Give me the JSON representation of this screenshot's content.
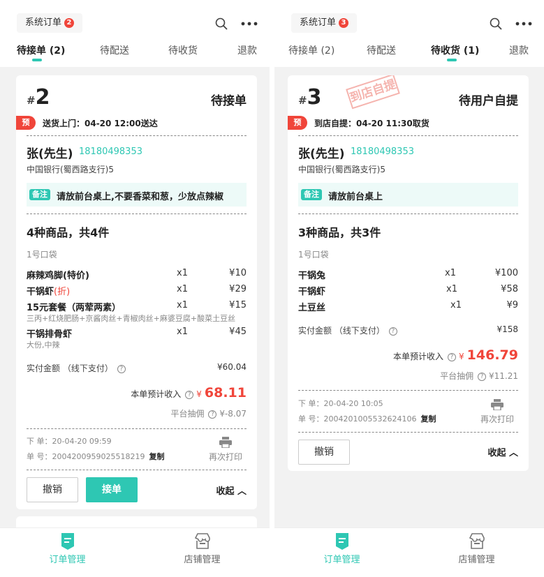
{
  "colors": {
    "accent": "#2ec7b3",
    "red": "#f0453a",
    "bg": "#f2f2f2"
  },
  "screens": [
    {
      "header": {
        "system_orders_label": "系统订单",
        "badge": "2"
      },
      "tabs": [
        {
          "label": "待接单 (2)",
          "active": true
        },
        {
          "label": "待配送",
          "active": false
        },
        {
          "label": "待收货",
          "active": false
        },
        {
          "label": "退款",
          "active": false
        }
      ],
      "order": {
        "hash": "#",
        "number": "2",
        "status": "待接单",
        "pre_tag": "预",
        "pre_text": "送货上门：04-20 12:00送达",
        "customer_name": "张(先生)",
        "customer_phone": "18180498353",
        "address": "中国银行(蜀西路支行)5",
        "remark_tag": "备注",
        "remark_text": "请放前台桌上,不要香菜和葱，少放点辣椒",
        "goods_summary": "4种商品，共4件",
        "bag": "1号口袋",
        "items": [
          {
            "name": "麻辣鸡脚(特价)",
            "tag": "",
            "qty": "x1",
            "price": "¥10",
            "sub": ""
          },
          {
            "name": "干锅虾",
            "tag": "(折)",
            "qty": "x1",
            "price": "¥29",
            "sub": ""
          },
          {
            "name": "15元套餐（两荤两素）",
            "tag": "",
            "qty": "x1",
            "price": "¥15",
            "sub": "三丙+红烧肥肠+京酱肉丝+青椒肉丝+麻婆豆腐+酸菜土豆丝"
          },
          {
            "name": "干锅排骨虾",
            "tag": "",
            "qty": "x1",
            "price": "¥45",
            "sub": "大份,中辣"
          }
        ],
        "paid_label": "实付金额 （线下支付）",
        "paid_value": "¥60.04",
        "income_label": "本单预计收入",
        "income_currency": "¥",
        "income_value": "68.11",
        "fee_label": "平台抽佣",
        "fee_value": "¥-8.07",
        "order_time": "下 单：20-04-20 09:59",
        "order_id": "单 号：2004200959025518219",
        "copy_label": "复制",
        "reprint_label": "再次打印",
        "cancel_label": "撤销",
        "accept_label": "接单",
        "collapse_label": "收起 ︿"
      },
      "nav": [
        {
          "label": "订单管理",
          "icon": "order-icon",
          "active": true
        },
        {
          "label": "店铺管理",
          "icon": "store-icon",
          "active": false
        }
      ]
    },
    {
      "header": {
        "system_orders_label": "系统订单",
        "badge": "3"
      },
      "tabs": [
        {
          "label": "待接单 (2)",
          "active": false
        },
        {
          "label": "待配送",
          "active": false
        },
        {
          "label": "待收货 (1)",
          "active": true
        },
        {
          "label": "退款",
          "active": false
        }
      ],
      "order": {
        "hash": "#",
        "number": "3",
        "stamp": "到店自提",
        "status": "待用户自提",
        "pre_tag": "预",
        "pre_text": "到店自提：04-20 11:30取货",
        "customer_name": "张(先生)",
        "customer_phone": "18180498353",
        "address": "中国银行(蜀西路支行)5",
        "remark_tag": "备注",
        "remark_text": "请放前台桌上",
        "goods_summary": "3种商品，共3件",
        "bag": "1号口袋",
        "items": [
          {
            "name": "干锅兔",
            "qty": "x1",
            "price": "¥100"
          },
          {
            "name": "干锅虾",
            "qty": "x1",
            "price": "¥58"
          },
          {
            "name": "土豆丝",
            "qty": "x1",
            "price": "¥9"
          }
        ],
        "paid_label": "实付金额 （线下支付）",
        "paid_value": "¥158",
        "income_label": "本单预计收入",
        "income_currency": "¥",
        "income_value": "146.79",
        "fee_label": "平台抽佣",
        "fee_value": "¥11.21",
        "order_time": "下 单：20-04-20 10:05",
        "order_id": "单 号：2004201005532624106",
        "copy_label": "复制",
        "reprint_label": "再次打印",
        "cancel_label": "撤销",
        "collapse_label": "收起 ︿"
      },
      "nav": [
        {
          "label": "订单管理",
          "icon": "order-icon",
          "active": true
        },
        {
          "label": "店铺管理",
          "icon": "store-icon",
          "active": false
        }
      ]
    }
  ]
}
